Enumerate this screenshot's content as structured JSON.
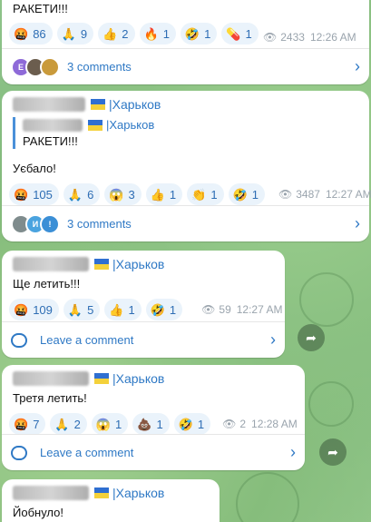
{
  "channel_name": "|Харьков",
  "msg0": {
    "text": "РАКЕТИ!!!",
    "reactions": [
      {
        "emoji": "🤬",
        "count": "86"
      },
      {
        "emoji": "🙏",
        "count": "9"
      },
      {
        "emoji": "👍",
        "count": "2"
      },
      {
        "emoji": "🔥",
        "count": "1"
      },
      {
        "emoji": "🤣",
        "count": "1"
      },
      {
        "emoji": "💊",
        "count": "1"
      }
    ],
    "views": "2433",
    "time": "12:26 AM",
    "comments": "3 comments",
    "avatar_letter": "E"
  },
  "msg1": {
    "reply_channel": "|Харьков",
    "reply_text": "РАКЕТИ!!!",
    "text": "Уєбало!",
    "reactions": [
      {
        "emoji": "🤬",
        "count": "105"
      },
      {
        "emoji": "🙏",
        "count": "6"
      },
      {
        "emoji": "😱",
        "count": "3"
      },
      {
        "emoji": "👍",
        "count": "1"
      },
      {
        "emoji": "👏",
        "count": "1"
      },
      {
        "emoji": "🤣",
        "count": "1"
      }
    ],
    "views": "3487",
    "time": "12:27 AM",
    "comments": "3 comments",
    "avatar_letters": [
      "И",
      "!"
    ]
  },
  "msg2": {
    "text": "Ще летить!!!",
    "reactions": [
      {
        "emoji": "🤬",
        "count": "109"
      },
      {
        "emoji": "🙏",
        "count": "5"
      },
      {
        "emoji": "👍",
        "count": "1"
      },
      {
        "emoji": "🤣",
        "count": "1"
      }
    ],
    "views": "59",
    "time": "12:27 AM",
    "comment_label": "Leave a comment"
  },
  "msg3": {
    "text": "Третя летить!",
    "reactions": [
      {
        "emoji": "🤬",
        "count": "7"
      },
      {
        "emoji": "🙏",
        "count": "2"
      },
      {
        "emoji": "😱",
        "count": "1"
      },
      {
        "emoji": "💩",
        "count": "1"
      },
      {
        "emoji": "🤣",
        "count": "1"
      }
    ],
    "views": "2",
    "time": "12:28 AM",
    "comment_label": "Leave a comment"
  },
  "msg4": {
    "text": "Йобнуло!"
  },
  "colors": {
    "accent": "#2f79c5",
    "reaction_bg": "#eaf3fb",
    "chat_bg": "#86bd7c"
  }
}
